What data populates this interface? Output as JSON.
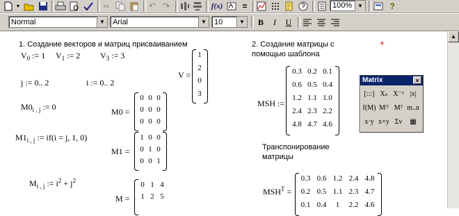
{
  "toolbar": {
    "zoom": "100%",
    "help_label": "?",
    "icons": [
      "new-document-icon",
      "open-folder-icon",
      "save-icon",
      "print-icon",
      "print-preview-icon",
      "spell-check-icon",
      "cut-icon",
      "copy-icon",
      "paste-icon",
      "undo-icon",
      "redo-icon",
      "align-across-icon",
      "align-down-icon",
      "insert-function-icon",
      "insert-unit-icon",
      "calculate-icon",
      "insert-graph-icon",
      "insert-matrix-icon",
      "resources-icon",
      "help-icon"
    ]
  },
  "format": {
    "style": "Normal",
    "font": "Arial",
    "size": "10",
    "bold": "B",
    "italic": "I",
    "underline": "U"
  },
  "worksheet": {
    "section1_title": "1. Создание векторов и матриц присваиванием",
    "v0": [
      "V",
      "0",
      ":= 1"
    ],
    "v1": [
      "V",
      "1",
      ":= 2"
    ],
    "v3": [
      "V",
      "3",
      ":= 3"
    ],
    "j_range": "j := 0.. 2",
    "i_range": "i := 0.. 2",
    "V_label": "V =",
    "V_values": [
      "1",
      "2",
      "0",
      "3"
    ],
    "m0_def": [
      "M0",
      "i , j",
      ":= 0"
    ],
    "M0_label": "M0 =",
    "M0_values": [
      "0",
      "0",
      "0",
      "0",
      "0",
      "0",
      "0",
      "0",
      "0"
    ],
    "m1_def": [
      "M1",
      "i , j",
      ":= if(i = j, 1, 0)"
    ],
    "M1_label": "M1 =",
    "M1_values": [
      "1",
      "0",
      "0",
      "0",
      "1",
      "0",
      "0",
      "0",
      "1"
    ],
    "m_def": [
      "M",
      "i , j",
      ":= i",
      "2",
      " + j",
      "2"
    ],
    "M_label": "M =",
    "M_values": [
      "0",
      "1",
      "4",
      "1",
      "2",
      "5"
    ],
    "section2_title_1": "2. Создание матрицы с",
    "section2_title_2": "помощью шаблона",
    "MSH_label": "MSH :=",
    "MSH_values": [
      "0.3",
      "0.2",
      "0.1",
      "0.6",
      "0.5",
      "0.4",
      "1.2",
      "1.1",
      "1.0",
      "2.4",
      "2.3",
      "2.2",
      "4.8",
      "4.7",
      "4.6"
    ],
    "transpose_title_1": "Транспонирование",
    "transpose_title_2": "матрицы",
    "MSHT_label": [
      "MSH",
      "T",
      " ="
    ],
    "MSHT_values": [
      "0.3",
      "0.6",
      "1.2",
      "2.4",
      "4.8",
      "0.2",
      "0.5",
      "1.1",
      "2.3",
      "4.7",
      "0.1",
      "0.4",
      "1",
      "2.2",
      "4.6"
    ]
  },
  "palette": {
    "title": "Matrix",
    "close": "×",
    "buttons": [
      "[:::]",
      "Xₙ",
      "X⁻¹",
      "|x|",
      "f(M)",
      "M⁽⁾",
      "Mᵀ",
      "m..n",
      "x·y",
      "x×y",
      "Σv",
      "▦"
    ]
  },
  "cursor": "+"
}
